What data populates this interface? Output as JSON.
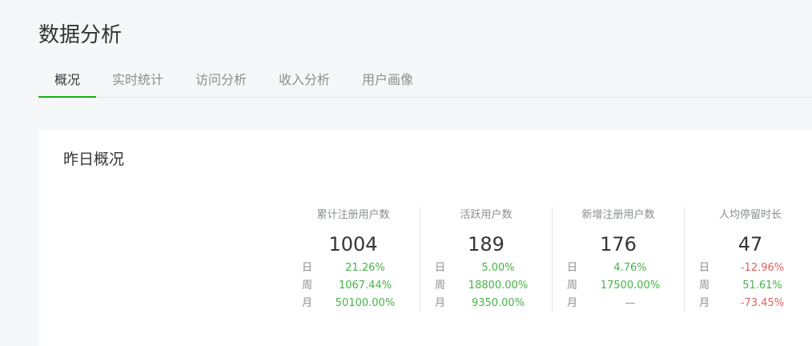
{
  "header": {
    "title": "数据分析"
  },
  "tabs": [
    {
      "label": "概况",
      "active": true
    },
    {
      "label": "实时统计",
      "active": false
    },
    {
      "label": "访问分析",
      "active": false
    },
    {
      "label": "收入分析",
      "active": false
    },
    {
      "label": "用户画像",
      "active": false
    }
  ],
  "overview": {
    "title": "昨日概况",
    "row_labels": {
      "day": "日",
      "week": "周",
      "month": "月"
    },
    "stats": [
      {
        "label": "累计注册用户数",
        "value": "1004",
        "day": "21.26%",
        "week": "1067.44%",
        "month": "50100.00%"
      },
      {
        "label": "活跃用户数",
        "value": "189",
        "day": "5.00%",
        "week": "18800.00%",
        "month": "9350.00%"
      },
      {
        "label": "新增注册用户数",
        "value": "176",
        "day": "4.76%",
        "week": "17500.00%",
        "month": "—"
      },
      {
        "label": "人均停留时长",
        "value": "47",
        "day": "-12.96%",
        "week": "51.61%",
        "month": "-73.45%"
      }
    ]
  },
  "colors": {
    "accent": "#1aad19",
    "increase": "#47b247",
    "decrease": "#e15f5f",
    "muted": "#8a8d92"
  }
}
